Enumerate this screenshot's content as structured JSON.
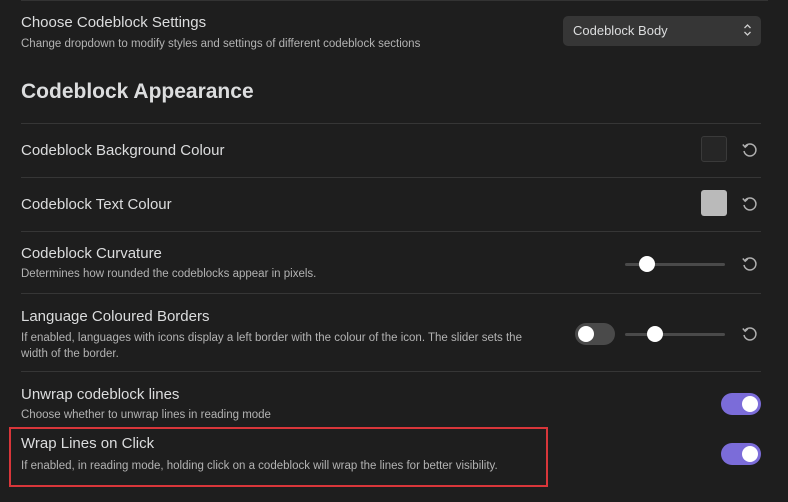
{
  "settings_section": {
    "choose_settings": {
      "name": "Choose Codeblock Settings",
      "description": "Change dropdown to modify styles and settings of different codeblock sections",
      "dropdown_value": "Codeblock Body"
    },
    "heading": "Codeblock Appearance",
    "background_colour": {
      "name": "Codeblock Background Colour",
      "swatch_color": "#262626"
    },
    "text_colour": {
      "name": "Codeblock Text Colour",
      "swatch_color": "#bababa"
    },
    "curvature": {
      "name": "Codeblock Curvature",
      "description": "Determines how rounded the codeblocks appear in pixels.",
      "slider_fraction": 0.22
    },
    "language_borders": {
      "name": "Language Coloured Borders",
      "description": "If enabled, languages with icons display a left border with the colour of the icon. The slider sets the width of the border.",
      "toggle_on": false,
      "slider_fraction": 0.3
    },
    "unwrap_lines": {
      "name": "Unwrap codeblock lines",
      "description": "Choose whether to unwrap lines in reading mode",
      "toggle_on": true
    },
    "wrap_on_click": {
      "name": "Wrap Lines on Click",
      "description": "If enabled, in reading mode, holding click on a codeblock will wrap the lines for better visibility.",
      "toggle_on": true
    }
  },
  "colors": {
    "accent": "#7b6cd9",
    "highlight_border": "#d8363a",
    "background": "#1e1e1e"
  },
  "icons": {
    "reset": "reset-icon",
    "dropdown_chevron": "chevron-updown-icon"
  }
}
